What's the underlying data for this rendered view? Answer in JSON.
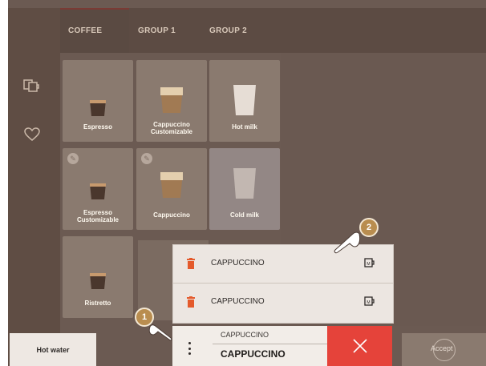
{
  "tabs": [
    {
      "label": "COFFEE",
      "active": true
    },
    {
      "label": "GROUP 1",
      "active": false
    },
    {
      "label": "GROUP 2",
      "active": false
    }
  ],
  "tiles": [
    {
      "label": "Espresso",
      "editable": false
    },
    {
      "label": "Cappuccino\nCustomizable",
      "editable": false
    },
    {
      "label": "Hot milk",
      "editable": false
    },
    {
      "label": "Espresso\nCustomizable",
      "editable": true
    },
    {
      "label": "Cappuccino",
      "editable": true
    },
    {
      "label": "Cold milk",
      "editable": false
    },
    {
      "label": "Ristretto",
      "editable": false
    }
  ],
  "queue": {
    "rows": [
      {
        "label": "CAPPUCCINO",
        "icon": "trash-icon",
        "drink_icon": "mug-icon"
      },
      {
        "label": "CAPPUCCINO",
        "icon": "trash-icon",
        "drink_icon": "mug-icon"
      }
    ],
    "current_small": "CAPPUCCINO",
    "current_big": "CAPPUCCINO"
  },
  "hot_water_label": "Hot water",
  "accept_label": "Accept",
  "annotations": {
    "one": "1",
    "two": "2"
  },
  "colors": {
    "accent_red": "#e5433a",
    "badge_gold": "#b98d4f",
    "trash_orange": "#e45a2b"
  }
}
